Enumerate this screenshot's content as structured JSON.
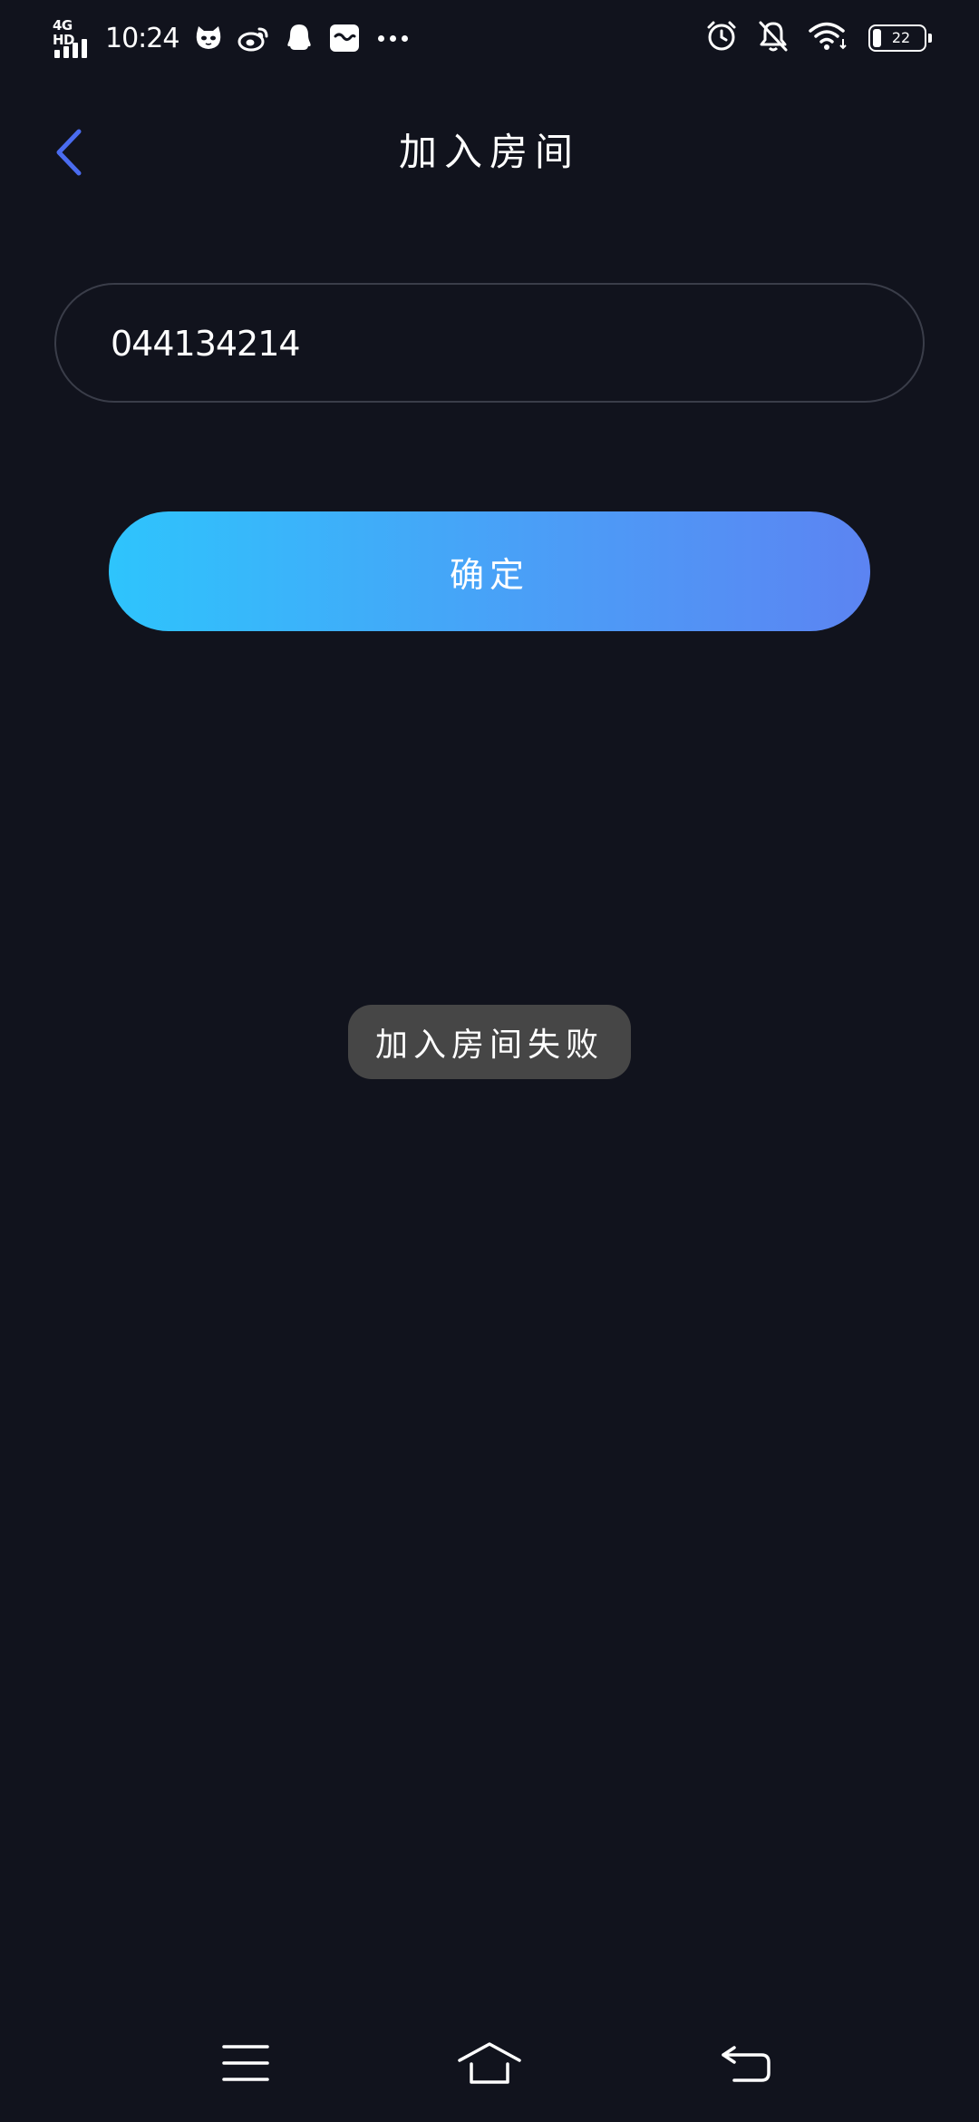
{
  "status_bar": {
    "network": "4G HD",
    "time": "10:24",
    "battery_level": "22",
    "left_icons": [
      "cat-app-icon",
      "weibo-icon",
      "qq-penguin-icon",
      "message-app-icon"
    ],
    "right_icons": [
      "alarm-icon",
      "mute-bell-icon",
      "wifi-icon",
      "battery-icon"
    ]
  },
  "header": {
    "title": "加入房间",
    "back_icon": "chevron-left-icon"
  },
  "room_input": {
    "value": "044134214"
  },
  "confirm_button": {
    "label": "确定"
  },
  "toast": {
    "message": "加入房间失败"
  },
  "nav_bar": {
    "items": [
      "menu-icon",
      "home-icon",
      "back-icon"
    ]
  },
  "colors": {
    "background": "#11131d",
    "accent_blue": "#4a6cf0",
    "button_gradient_start": "#2ec4fc",
    "button_gradient_end": "#5c84f2",
    "input_border": "#3a3d49",
    "toast_bg": "#464646"
  }
}
